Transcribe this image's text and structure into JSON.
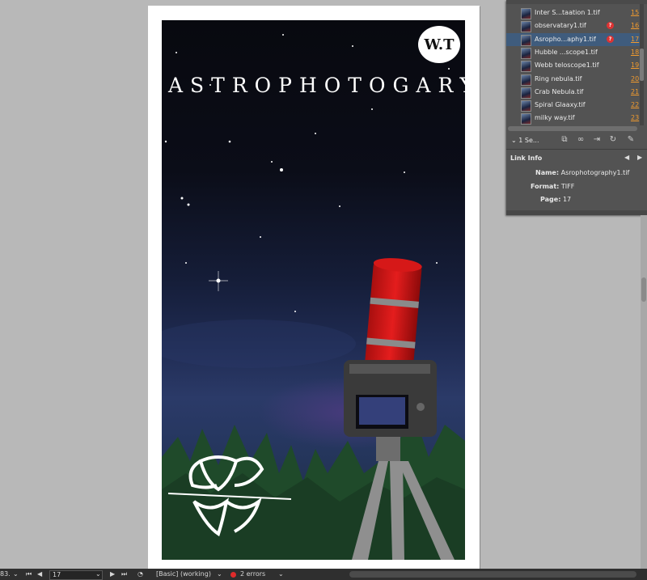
{
  "document": {
    "title": "ASTROPHOTOGARY",
    "badge": "W.T"
  },
  "links_panel": {
    "items": [
      {
        "name": "Inter S...taation 1.tif",
        "page": "15",
        "warning": false,
        "selected": false
      },
      {
        "name": "observatary1.tif",
        "page": "16",
        "warning": true,
        "selected": false
      },
      {
        "name": "Asropho...aphy1.tif",
        "page": "17",
        "warning": true,
        "selected": true
      },
      {
        "name": "Hubble ...scope1.tif",
        "page": "18",
        "warning": false,
        "selected": false
      },
      {
        "name": "Webb teloscope1.tif",
        "page": "19",
        "warning": false,
        "selected": false
      },
      {
        "name": "Ring nebula.tif",
        "page": "20",
        "warning": false,
        "selected": false
      },
      {
        "name": "Crab Nebula.tif",
        "page": "21",
        "warning": false,
        "selected": false
      },
      {
        "name": "Spiral Glaaxy.tif",
        "page": "22",
        "warning": false,
        "selected": false
      },
      {
        "name": "milky way.tif",
        "page": "23",
        "warning": false,
        "selected": false
      }
    ],
    "selection_count": "1 Se...",
    "warning_symbol": "?",
    "link_info": {
      "header": "Link Info",
      "name_label": "Name:",
      "name_value": "Asrophotography1.tif",
      "format_label": "Format:",
      "format_value": "TIFF",
      "page_label": "Page:",
      "page_value": "17"
    }
  },
  "statusbar": {
    "zoom": "83.",
    "page_field": "17",
    "preflight_profile": "[Basic] (working)",
    "errors": "2 errors"
  },
  "colors": {
    "selection": "#3f5c7d",
    "page_link": "#f09a2e",
    "error": "#e02b2b"
  }
}
